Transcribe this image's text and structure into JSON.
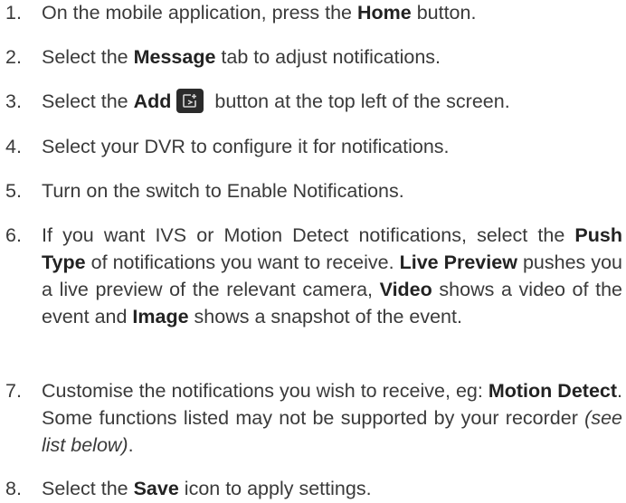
{
  "steps": [
    {
      "num": "1.",
      "t1": "On the mobile application, press the ",
      "b1": "Home",
      "t2": " button."
    },
    {
      "num": "2.",
      "t1": "Select the ",
      "b1": "Message",
      "t2": " tab to adjust notifications."
    },
    {
      "num": "3.",
      "t1": "Select the ",
      "b1": "Add",
      "t2": " button at the top left of the screen.",
      "icon": "add-device-icon"
    },
    {
      "num": "4.",
      "t1": "Select your DVR to configure it for notifications."
    },
    {
      "num": "5.",
      "t1": "Turn on the switch to Enable Notifications."
    },
    {
      "num": "6.",
      "t1": "If you want IVS or Motion Detect notifications, select the ",
      "b1": "Push Type",
      "t2": " of notifications you want to receive. ",
      "b2": "Live Preview",
      "t3": " pushes you a live preview of the relevant camera, ",
      "b3": "Video",
      "t4": " shows a video of the event and ",
      "b4": "Image",
      "t5": " shows a snapshot of the event."
    },
    {
      "num": "7.",
      "t1": "Customise the notifications you wish to receive, eg: ",
      "b1": "Motion Detect",
      "t2": ". Some functions listed may not be supported by your recorder ",
      "i1": "(see list below)",
      "t3": "."
    },
    {
      "num": "8.",
      "t1": "Select the ",
      "b1": "Save",
      "t2": " icon to apply settings."
    }
  ]
}
